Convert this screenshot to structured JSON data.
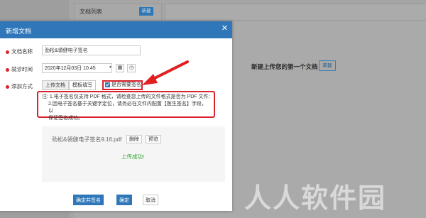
{
  "background": {
    "list_title": "文档列表",
    "new_button": "新建",
    "empty_hint": "新建上传您的第一个文档",
    "empty_hint_button": "新建",
    "watermark": "人人软件园"
  },
  "modal": {
    "title": "新增文档",
    "close_icon": "close-icon",
    "fields": {
      "doc_name_label": "文档名称",
      "doc_name_value": "劲松&領健电子签名",
      "visit_time_label": "就诊时间",
      "visit_time_value": "2020年12月03日 10:45",
      "add_method_label": "添加方式"
    },
    "tabs": [
      "上传文档",
      "模板填写"
    ],
    "sign_checkbox_label": "是否需要签名",
    "note_line1": "注: 1.电子签名仅支持 PDF 格式，请检查您上传的文件格式是否为 PDF 文件;",
    "note_line2": "2.因电子签名基于关键字定位，请务必在文件内配置【医生签名】字段，以",
    "note_line3": "保证签名成功。",
    "upload": {
      "file_name": "劲松&領健电子签名9.16.pdf",
      "delete_label": "删除",
      "preview_label": "预览",
      "status": "上传成功!"
    },
    "footer": {
      "confirm_sign_label": "确定并签名",
      "confirm_label": "确定",
      "cancel_label": "取消"
    }
  },
  "colors": {
    "primary": "#2f77b8",
    "danger": "#d9232d",
    "success": "#2aa62a"
  }
}
